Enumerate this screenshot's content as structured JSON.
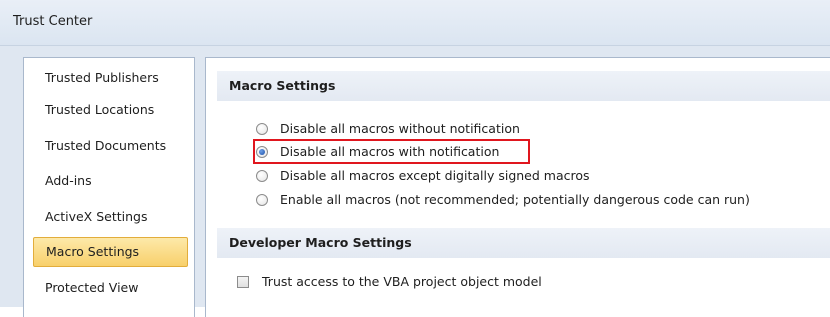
{
  "window": {
    "title": "Trust Center"
  },
  "sidebar": {
    "items": [
      {
        "label": "Trusted Publishers",
        "selected": false
      },
      {
        "label": "Trusted Locations",
        "selected": false
      },
      {
        "label": "Trusted Documents",
        "selected": false
      },
      {
        "label": "Add-ins",
        "selected": false
      },
      {
        "label": "ActiveX Settings",
        "selected": false
      },
      {
        "label": "Macro Settings",
        "selected": true
      },
      {
        "label": "Protected View",
        "selected": false
      }
    ]
  },
  "macro_settings": {
    "header": "Macro Settings",
    "options": [
      {
        "label": "Disable all macros without notification",
        "checked": false
      },
      {
        "label": "Disable all macros with notification",
        "checked": true
      },
      {
        "label": "Disable all macros except digitally signed macros",
        "checked": false
      },
      {
        "label": "Enable all macros (not recommended; potentially dangerous code can run)",
        "checked": false
      }
    ]
  },
  "developer_settings": {
    "header": "Developer Macro Settings",
    "checkbox_label": "Trust access to the VBA project object model",
    "checked": false
  },
  "colors": {
    "selection_fill": "#f8d06b",
    "selection_border": "#e2ad3b",
    "highlight_box": "#e0161e",
    "window_background": "#dfe7f1"
  }
}
